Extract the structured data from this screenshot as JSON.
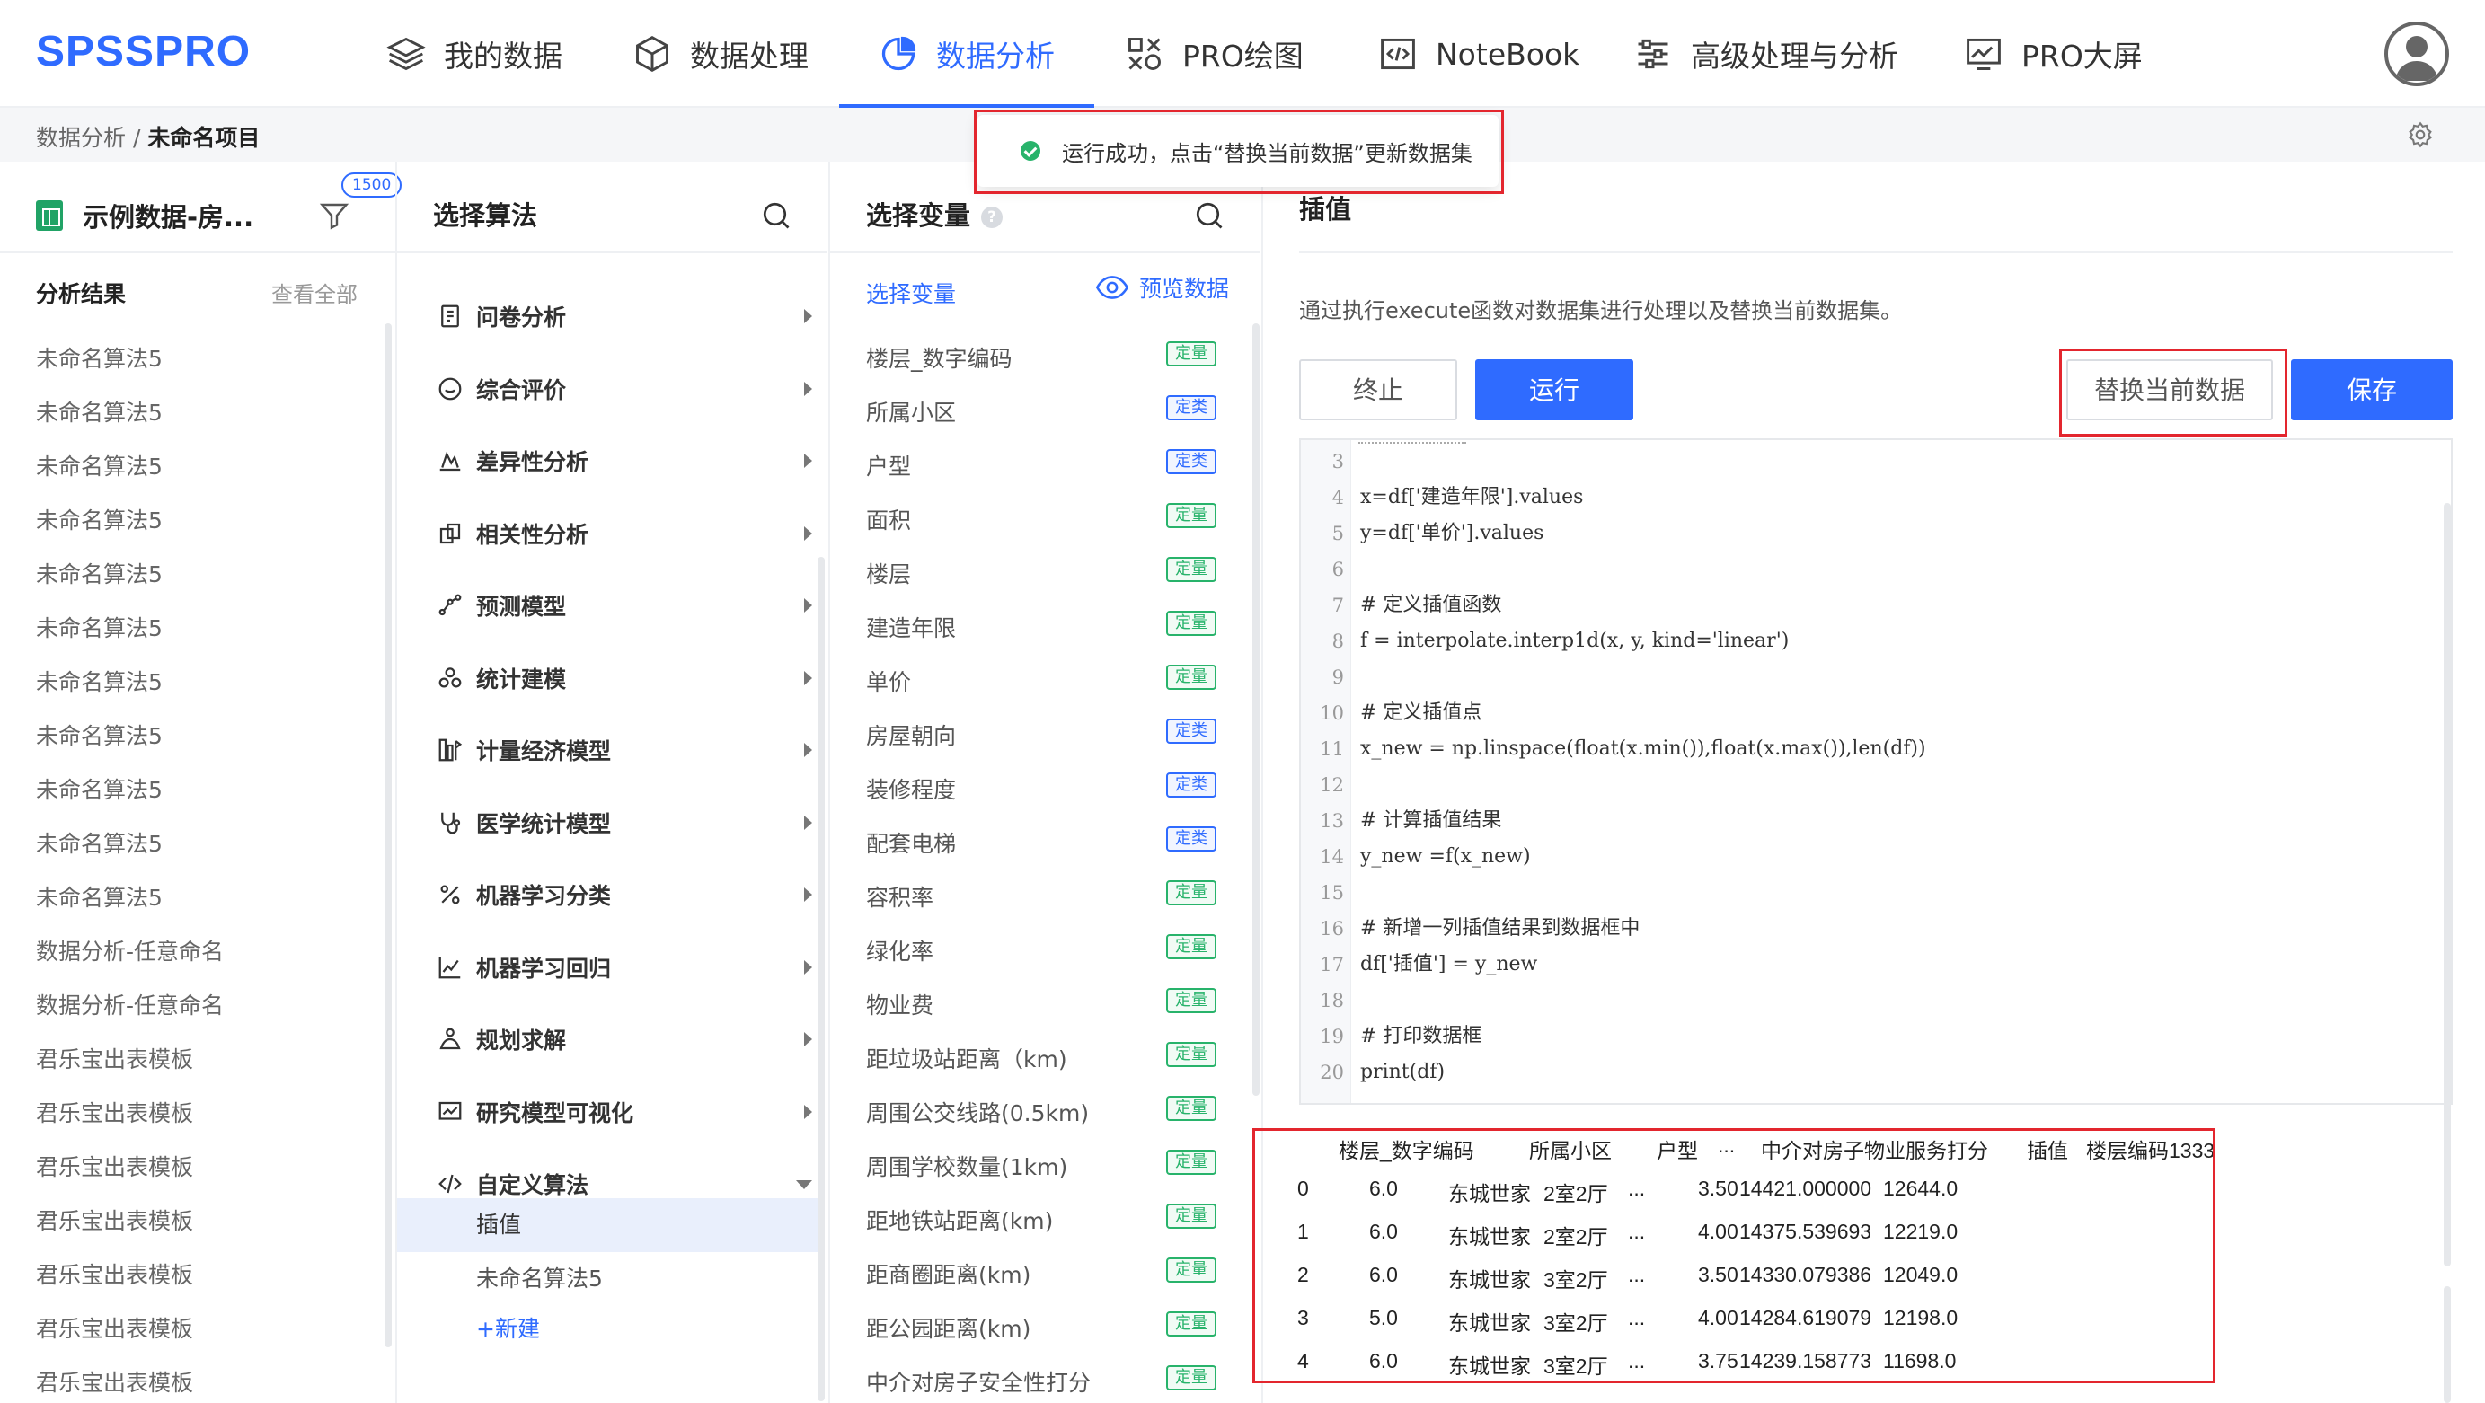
{
  "app": {
    "logo": "SPSSPRO"
  },
  "nav": [
    {
      "label": "我的数据",
      "icon": "layers-icon",
      "active": false
    },
    {
      "label": "数据处理",
      "icon": "cube-icon",
      "active": false
    },
    {
      "label": "数据分析",
      "icon": "pie-chart-icon",
      "active": true
    },
    {
      "label": "PRO绘图",
      "icon": "draw-tools-icon",
      "active": false
    },
    {
      "label": "NoteBook",
      "icon": "code-window-icon",
      "active": false
    },
    {
      "label": "高级处理与分析",
      "icon": "sliders-icon",
      "active": false
    },
    {
      "label": "PRO大屏",
      "icon": "monitor-chart-icon",
      "active": false
    }
  ],
  "breadcrumb": {
    "root": "数据分析",
    "separator": " / ",
    "current": "未命名项目"
  },
  "toast": {
    "message": "运行成功，点击“替换当前数据”更新数据集",
    "status_color": "#28b36b"
  },
  "colors": {
    "accent": "#2f6bff",
    "highlight_box": "#e3262e",
    "tag_continuous": "#28b36b",
    "tag_categorical": "#2f6bff"
  },
  "results_panel": {
    "dataset_name": "示例数据-房...",
    "badge_count": "1500",
    "heading": "分析结果",
    "view_all": "查看全部",
    "items": [
      "未命名算法5",
      "未命名算法5",
      "未命名算法5",
      "未命名算法5",
      "未命名算法5",
      "未命名算法5",
      "未命名算法5",
      "未命名算法5",
      "未命名算法5",
      "未命名算法5",
      "未命名算法5",
      "数据分析-任意命名",
      "数据分析-任意命名",
      "君乐宝出表模板",
      "君乐宝出表模板",
      "君乐宝出表模板",
      "君乐宝出表模板",
      "君乐宝出表模板",
      "君乐宝出表模板",
      "君乐宝出表模板"
    ]
  },
  "algorithm_panel": {
    "title": "选择算法",
    "categories": [
      {
        "label": "问卷分析",
        "icon": "survey-icon",
        "expanded": false
      },
      {
        "label": "综合评价",
        "icon": "rating-icon",
        "expanded": false
      },
      {
        "label": "差异性分析",
        "icon": "difference-chart-icon",
        "expanded": false
      },
      {
        "label": "相关性分析",
        "icon": "correlation-icon",
        "expanded": false
      },
      {
        "label": "预测模型",
        "icon": "prediction-icon",
        "expanded": false
      },
      {
        "label": "统计建模",
        "icon": "modeling-icon",
        "expanded": false
      },
      {
        "label": "计量经济模型",
        "icon": "econometrics-icon",
        "expanded": false
      },
      {
        "label": "医学统计模型",
        "icon": "stethoscope-icon",
        "expanded": false
      },
      {
        "label": "机器学习分类",
        "icon": "percent-icon",
        "expanded": false
      },
      {
        "label": "机器学习回归",
        "icon": "regression-icon",
        "expanded": false
      },
      {
        "label": "规划求解",
        "icon": "planning-icon",
        "expanded": false
      },
      {
        "label": "研究模型可视化",
        "icon": "visualization-icon",
        "expanded": false
      },
      {
        "label": "自定义算法",
        "icon": "code-icon",
        "expanded": true
      }
    ],
    "custom_items": [
      {
        "label": "插值",
        "selected": true
      },
      {
        "label": "未命名算法5",
        "selected": false
      }
    ],
    "new_label": "+新建"
  },
  "variable_panel": {
    "title": "选择变量",
    "subheading": "选择变量",
    "preview_label": "预览数据",
    "variables": [
      {
        "name": "楼层_数字编码",
        "type": "定量"
      },
      {
        "name": "所属小区",
        "type": "定类"
      },
      {
        "name": "户型",
        "type": "定类"
      },
      {
        "name": "面积",
        "type": "定量"
      },
      {
        "name": "楼层",
        "type": "定量"
      },
      {
        "name": "建造年限",
        "type": "定量"
      },
      {
        "name": "单价",
        "type": "定量"
      },
      {
        "name": "房屋朝向",
        "type": "定类"
      },
      {
        "name": "装修程度",
        "type": "定类"
      },
      {
        "name": "配套电梯",
        "type": "定类"
      },
      {
        "name": "容积率",
        "type": "定量"
      },
      {
        "name": "绿化率",
        "type": "定量"
      },
      {
        "name": "物业费",
        "type": "定量"
      },
      {
        "name": "距垃圾站距离（km)",
        "type": "定量"
      },
      {
        "name": "周围公交线路(0.5km)",
        "type": "定量"
      },
      {
        "name": "周围学校数量(1km)",
        "type": "定量"
      },
      {
        "name": "距地铁站距离(km)",
        "type": "定量"
      },
      {
        "name": "距商圈距离(km)",
        "type": "定量"
      },
      {
        "name": "距公园距离(km)",
        "type": "定量"
      },
      {
        "name": "中介对房子安全性打分",
        "type": "定量"
      }
    ]
  },
  "editor_panel": {
    "title": "插值",
    "description": "通过执行execute函数对数据集进行处理以及替换当前数据集。",
    "buttons": {
      "stop": "终止",
      "run": "运行",
      "replace": "替换当前数据",
      "save": "保存"
    },
    "code_lines": [
      {
        "n": "3",
        "text": ""
      },
      {
        "n": "4",
        "text": "x=df['建造年限'].values"
      },
      {
        "n": "5",
        "text": "y=df['单价'].values"
      },
      {
        "n": "6",
        "text": ""
      },
      {
        "n": "7",
        "text": "# 定义插值函数"
      },
      {
        "n": "8",
        "text": "f = interpolate.interp1d(x, y, kind='linear')"
      },
      {
        "n": "9",
        "text": ""
      },
      {
        "n": "10",
        "text": "# 定义插值点"
      },
      {
        "n": "11",
        "text": "x_new = np.linspace(float(x.min()),float(x.max()),len(df))"
      },
      {
        "n": "12",
        "text": ""
      },
      {
        "n": "13",
        "text": "# 计算插值结果"
      },
      {
        "n": "14",
        "text": "y_new =f(x_new)"
      },
      {
        "n": "15",
        "text": ""
      },
      {
        "n": "16",
        "text": "# 新增一列插值结果到数据框中"
      },
      {
        "n": "17",
        "text": "df['插值'] = y_new"
      },
      {
        "n": "18",
        "text": ""
      },
      {
        "n": "19",
        "text": "# 打印数据框"
      },
      {
        "n": "20",
        "text": "print(df)"
      }
    ],
    "output": {
      "header": [
        "楼层_数字编码",
        "所属小区",
        "户型",
        "...",
        "中介对房子物业服务打分",
        "插值",
        "楼层编码1333"
      ],
      "rows": [
        [
          "0",
          "6.0",
          "东城世家",
          "2室2厅",
          "...",
          "3.50",
          "14421.000000",
          "12644.0"
        ],
        [
          "1",
          "6.0",
          "东城世家",
          "2室2厅",
          "...",
          "4.00",
          "14375.539693",
          "12219.0"
        ],
        [
          "2",
          "6.0",
          "东城世家",
          "3室2厅",
          "...",
          "3.50",
          "14330.079386",
          "12049.0"
        ],
        [
          "3",
          "5.0",
          "东城世家",
          "3室2厅",
          "...",
          "4.00",
          "14284.619079",
          "12198.0"
        ],
        [
          "4",
          "6.0",
          "东城世家",
          "3室2厅",
          "...",
          "3.75",
          "14239.158773",
          "11698.0"
        ]
      ]
    }
  }
}
